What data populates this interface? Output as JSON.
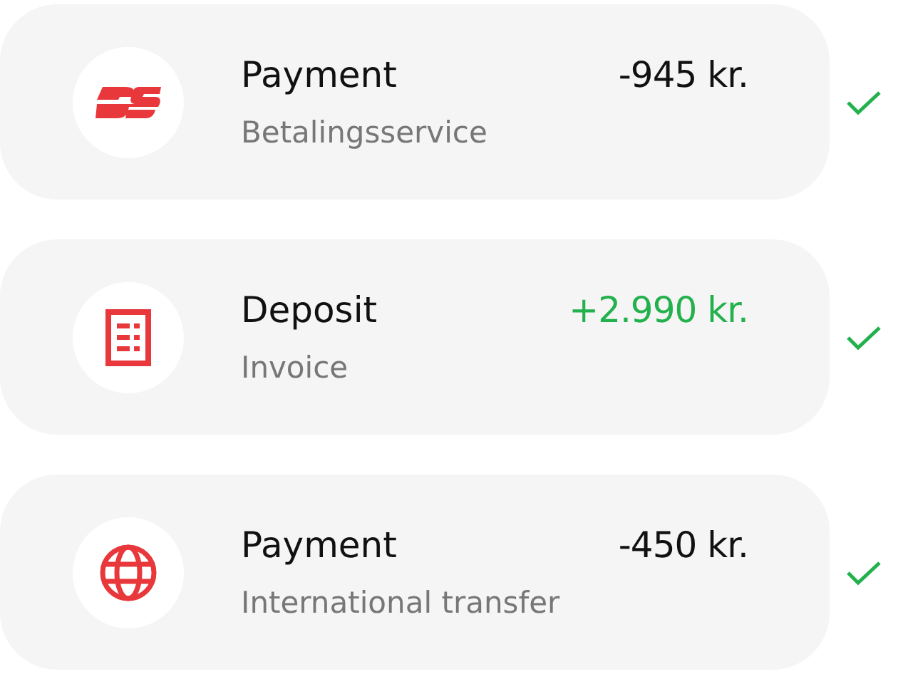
{
  "transactions": [
    {
      "kind": "direct-debit",
      "title": "Payment",
      "subtitle": "Betalingsservice",
      "amount": "-945 kr.",
      "positive": false,
      "completed": true
    },
    {
      "kind": "invoice",
      "title": "Deposit",
      "subtitle": "Invoice",
      "amount": "+2.990 kr.",
      "positive": true,
      "completed": true
    },
    {
      "kind": "globe",
      "title": "Payment",
      "subtitle": "International transfer",
      "amount": "-450 kr.",
      "positive": false,
      "completed": true
    }
  ]
}
